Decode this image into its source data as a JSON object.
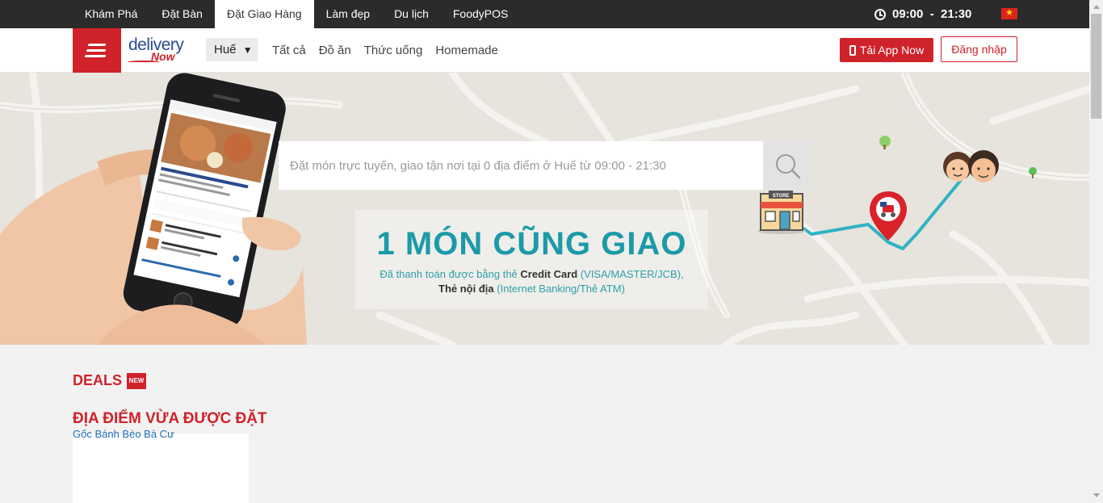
{
  "topnav": {
    "items": [
      {
        "label": "Khám Phá",
        "active": false
      },
      {
        "label": "Đặt Bàn",
        "active": false
      },
      {
        "label": "Đặt Giao Hàng",
        "active": true
      },
      {
        "label": "Làm đẹp",
        "active": false
      },
      {
        "label": "Du lịch",
        "active": false
      },
      {
        "label": "FoodyPOS",
        "active": false
      }
    ],
    "hours": "09:00  -  21:30",
    "clock_icon": "clock-icon",
    "flag_icon": "vietnam-flag-icon"
  },
  "header": {
    "logo_line1": "delivery",
    "logo_line2": "Now",
    "city": "Huế",
    "city_caret": "▼",
    "categories": [
      "Tất cả",
      "Đồ ăn",
      "Thức uống",
      "Homemade"
    ],
    "app_button": "Tải App Now",
    "login_button": "Đăng nhập"
  },
  "banner": {
    "search_placeholder": "Đặt món trực tuyến, giao tận nơi tại 0 địa điểm ở Huế từ 09:00 - 21:30",
    "promo_title": "1 MÓN CŨNG GIAO",
    "promo_line1_a": "Đã thanh toán được bằng thẻ ",
    "promo_line1_b": "Credit Card",
    "promo_line1_c": " (VISA/MASTER/JCB),",
    "promo_line2_a": "Thẻ nội địa",
    "promo_line2_b": " (Internet Banking/Thẻ ATM)",
    "store_label": "STORE"
  },
  "content": {
    "deals_title": "DEALS",
    "deals_badge": "NEW",
    "recent_title": "ĐỊA ĐIỂM VỪA ĐƯỢC ĐẶT",
    "recent_places": [
      "Gốc Bánh Bèo Bà Cư"
    ]
  },
  "colors": {
    "brand_red": "#d0222a",
    "topbar": "#2b2b2b",
    "promo_teal": "#1b9aa8",
    "route": "#2fb3c2"
  }
}
